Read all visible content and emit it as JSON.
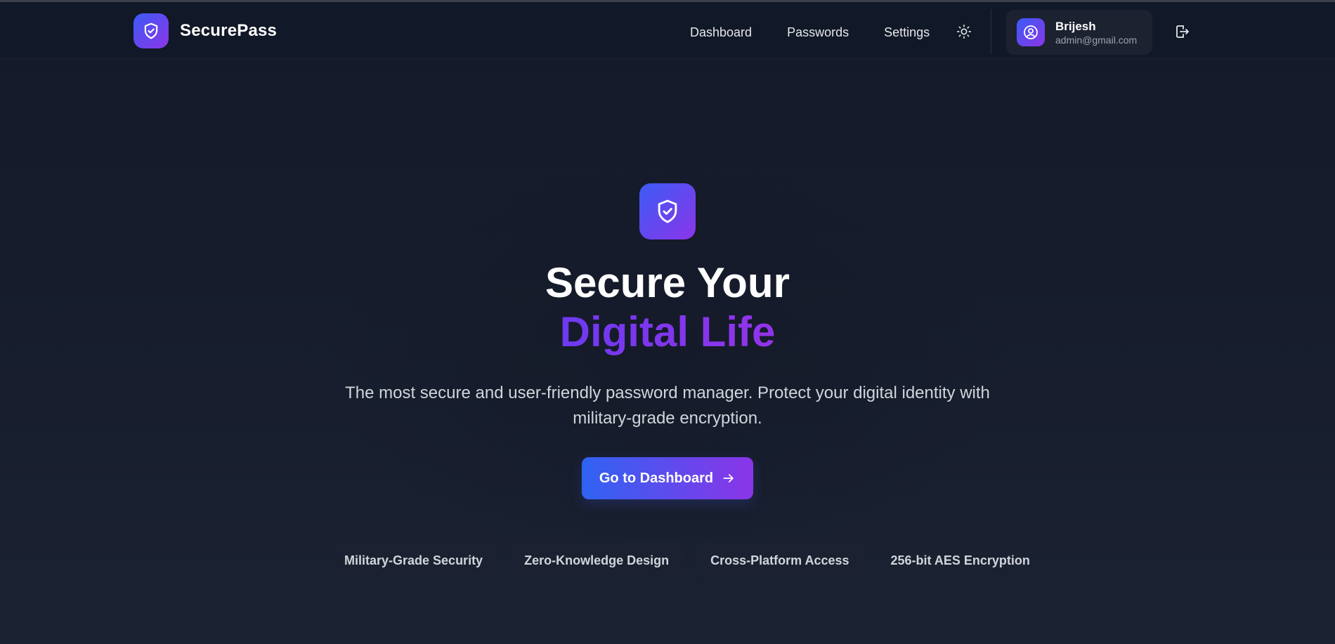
{
  "brand": {
    "name": "SecurePass",
    "logo_icon": "shield-check-icon"
  },
  "nav": {
    "links": [
      "Dashboard",
      "Passwords",
      "Settings"
    ],
    "theme_icon": "sun-icon",
    "logout_icon": "logout-icon"
  },
  "user": {
    "name": "Brijesh",
    "email": "admin@gmail.com",
    "avatar_icon": "user-circle-icon"
  },
  "hero": {
    "icon": "shield-check-icon",
    "title_line1": "Secure Your",
    "title_line2": "Digital Life",
    "subtitle": "The most secure and user-friendly password manager. Protect your digital identity with military-grade encryption.",
    "cta_label": "Go to Dashboard",
    "cta_icon": "arrow-right-icon"
  },
  "features": [
    "Military-Grade Security",
    "Zero-Knowledge Design",
    "Cross-Platform Access",
    "256-bit AES Encryption"
  ],
  "colors": {
    "accent_start": "#3b5bf6",
    "accent_end": "#8b35e8",
    "background": "#141a2a",
    "navbar": "#111827"
  }
}
